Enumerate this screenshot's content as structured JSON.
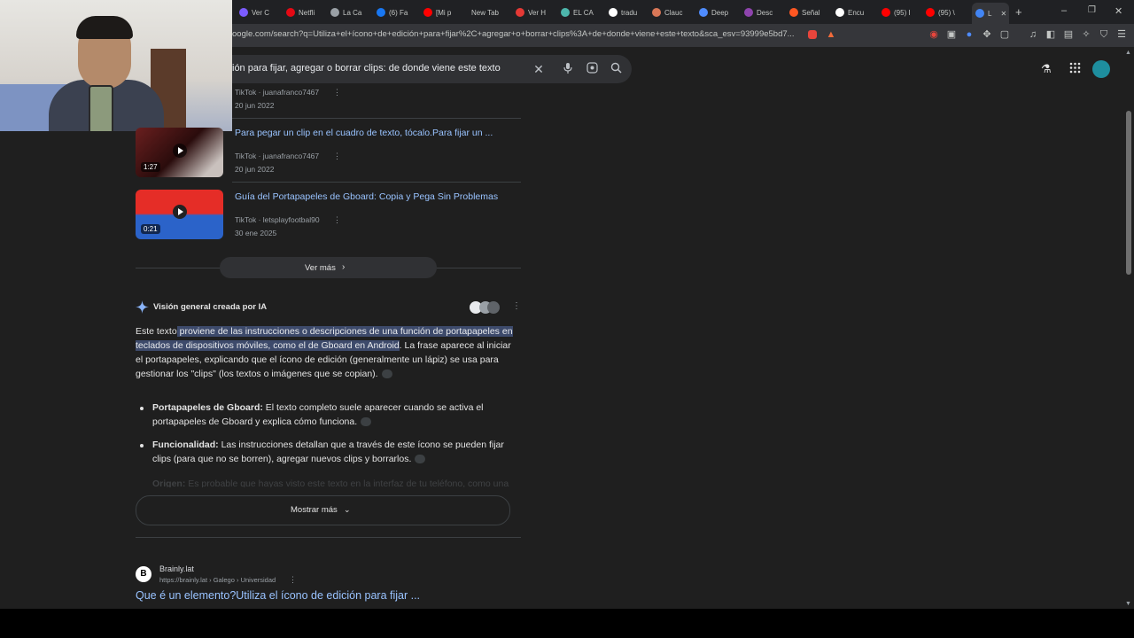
{
  "browser": {
    "tabs": [
      {
        "label": "Ver C",
        "color": "#7b5cff"
      },
      {
        "label": "Netfli",
        "color": "#e50914"
      },
      {
        "label": "La Ca",
        "color": "#9aa0a6"
      },
      {
        "label": "(6) Fa",
        "color": "#1877f2"
      },
      {
        "label": "[Mi p",
        "color": "#ff0000"
      },
      {
        "label": "New Tab",
        "color": ""
      },
      {
        "label": "Ver H",
        "color": "#e53935"
      },
      {
        "label": "EL CA",
        "color": "#4db6ac"
      },
      {
        "label": "tradu",
        "color": "#ffffff"
      },
      {
        "label": "Clauc",
        "color": "#d97757"
      },
      {
        "label": "Deep",
        "color": "#4f8cff"
      },
      {
        "label": "Desc",
        "color": "#8e44ad"
      },
      {
        "label": "Señal",
        "color": "#ff5722"
      },
      {
        "label": "Encu",
        "color": "#ffffff"
      },
      {
        "label": "(95) I",
        "color": "#ff0000"
      },
      {
        "label": "(95) \\",
        "color": "#ff0000"
      },
      {
        "label": "L",
        "color": "#4285f4"
      }
    ],
    "new_tab_label": "+",
    "url": "oogle.com/search?q=Utiliza+el+ícono+de+edición+para+fijar%2C+agregar+o+borrar+clips%3A+de+donde+viene+este+texto&sca_esv=93999e5bd7...",
    "window_controls": {
      "minimize": "–",
      "restore": "❐",
      "close": "✕"
    }
  },
  "search": {
    "query": "ión para fijar, agregar o borrar clips: de donde viene este texto"
  },
  "videos": [
    {
      "title": "",
      "source": "TikTok · juanafranco7467",
      "date": "20 jun 2022",
      "duration": ""
    },
    {
      "title": "Para pegar un clip en el cuadro de texto, tócalo.Para fijar un ...",
      "source": "TikTok · juanafranco7467",
      "date": "20 jun 2022",
      "duration": "1:27"
    },
    {
      "title": "Guía del Portapapeles de Gboard: Copia y Pega Sin Problemas",
      "source": "TikTok · letsplayfootbal90",
      "date": "30 ene 2025",
      "duration": "0:21"
    }
  ],
  "ver_mas": "Ver más",
  "ai": {
    "heading": "Visión general creada por IA",
    "intro": "Este texto",
    "highlighted": " proviene de las instrucciones o descripciones de una función de portapapeles en teclados de dispositivos móviles, como el de Gboard en Android",
    "rest": ". La frase aparece al iniciar el portapapeles, explicando que el ícono de edición (generalmente un lápiz) se usa para gestionar los \"clips\" (los textos o imágenes que se copian).",
    "bullets": [
      {
        "term": "Portapapeles de Gboard:",
        "text": " El texto completo suele aparecer cuando se activa el portapapeles de Gboard y explica cómo funciona."
      },
      {
        "term": "Funcionalidad:",
        "text": " Las instrucciones detallan que a través de este ícono se pueden fijar clips (para que no se borren), agregar nuevos clips y borrarlos."
      },
      {
        "term": "Origen:",
        "text": " Es probable que hayas visto este texto en la interfaz de tu teléfono, como una"
      }
    ],
    "show_more": "Mostrar más"
  },
  "result": {
    "site": "Brainly.lat",
    "breadcrumb": "https://brainly.lat › Galego › Universidad",
    "title": "Que é un elemento?Utiliza el ícono de edición para fijar ...",
    "logo_letter": "B"
  }
}
